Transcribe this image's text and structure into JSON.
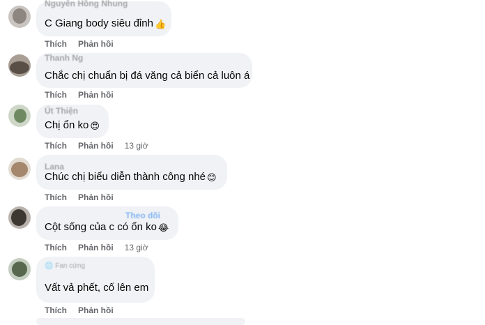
{
  "comments": [
    {
      "author": "Nguyễn Hồng Nhung",
      "text": "C Giang body siêu đỉnh",
      "emoji": "👍",
      "like": "Thích",
      "reply": "Phản hồi",
      "time": ""
    },
    {
      "author": "Thanh Ng",
      "text": "Chắc chị chuẩn bị đá văng cả biển cả luôn á",
      "emoji": "",
      "like": "Thích",
      "reply": "Phản hồi",
      "time": ""
    },
    {
      "author": "Út Thiện",
      "text": "Chị ổn ko",
      "emoji": "😍",
      "like": "Thích",
      "reply": "Phản hồi",
      "time": "13 giờ"
    },
    {
      "author": "Lana",
      "text": "Chúc chị biểu diễn thành công nhé",
      "emoji": "😊",
      "like": "Thích",
      "reply": "Phản hồi",
      "time": ""
    },
    {
      "author": "",
      "follow": "Theo dõi",
      "text": "Cột sống của c có ổn ko",
      "emoji": "😂",
      "like": "Thích",
      "reply": "Phản hồi",
      "time": "13 giờ"
    },
    {
      "author": "Fan cứng",
      "text": "Vất vả phết, cố lên em",
      "emoji": "",
      "like": "Thích",
      "reply": "Phản hồi",
      "time": ""
    }
  ]
}
